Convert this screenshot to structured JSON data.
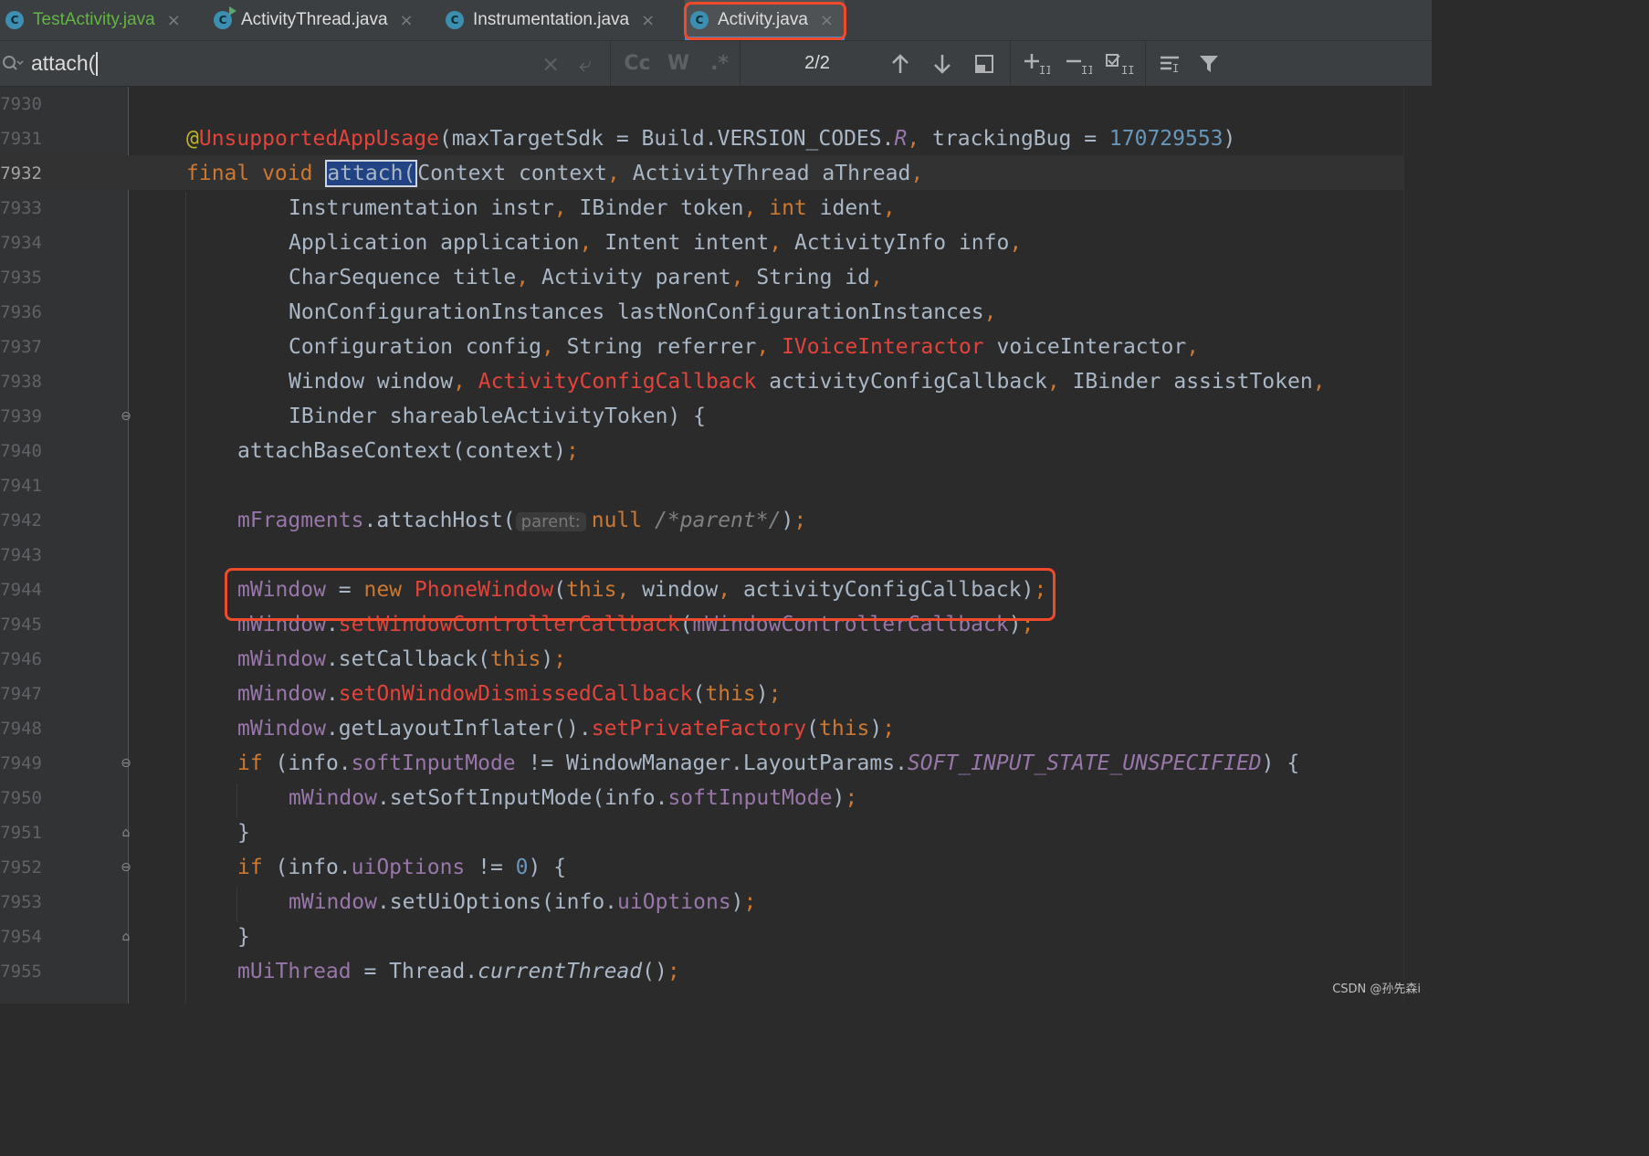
{
  "tabs": [
    {
      "label": "TestActivity.java",
      "close": "×"
    },
    {
      "label": "ActivityThread.java",
      "close": "×"
    },
    {
      "label": "Instrumentation.java",
      "close": "×"
    },
    {
      "label": "Activity.java",
      "close": "×"
    }
  ],
  "tab_icon_letter": "C",
  "search": {
    "query": "attach(",
    "match_count": "2/2",
    "case_toggle": "Cc",
    "words_toggle": "W",
    "regex_toggle": ".*",
    "clear": "×",
    "history": "⤶"
  },
  "highlight_colors": {
    "callout_box": "#ef4a2b",
    "search_match": "#214283",
    "active_tab_underline": "#4a88c7"
  },
  "line_numbers": [
    "7930",
    "7931",
    "7932",
    "7933",
    "7934",
    "7935",
    "7936",
    "7937",
    "7938",
    "7939",
    "7940",
    "7941",
    "7942",
    "7943",
    "7944",
    "7945",
    "7946",
    "7947",
    "7948",
    "7949",
    "7950",
    "7951",
    "7952",
    "7953",
    "7954",
    "7955"
  ],
  "current_line": "7932",
  "code": {
    "l7931_at": "@",
    "l7931_ann": "UnsupportedAppUsage",
    "l7931_mid": "(maxTargetSdk = Build.VERSION_CODES.",
    "l7931_r": "R",
    "l7931_comma": ",",
    "l7931_tb": " trackingBug = ",
    "l7931_num": "170729553",
    "l7931_end": ")",
    "l7932_kw": "final void ",
    "l7932_match": "attach(",
    "l7932_a": "Context context",
    "l7932_c1": ",",
    "l7932_b": " ActivityThread aThread",
    "l7932_c2": ",",
    "l7933_a": "Instrumentation instr",
    "l7933_c1": ",",
    "l7933_b": " IBinder token",
    "l7933_c2": ",",
    "l7933_kw": " int",
    "l7933_c": " ident",
    "l7933_c3": ",",
    "l7934_a": "Application application",
    "l7934_c1": ",",
    "l7934_b": " Intent intent",
    "l7934_c2": ",",
    "l7934_c": " ActivityInfo info",
    "l7934_c3": ",",
    "l7935_a": "CharSequence title",
    "l7935_c1": ",",
    "l7935_b": " Activity parent",
    "l7935_c2": ",",
    "l7935_c": " String id",
    "l7935_c3": ",",
    "l7936_a": "NonConfigurationInstances lastNonConfigurationInstances",
    "l7936_c1": ",",
    "l7937_a": "Configuration config",
    "l7937_c1": ",",
    "l7937_b": " String referrer",
    "l7937_c2": ",",
    "l7937_err": " IVoiceInteractor",
    "l7937_c": " voiceInteractor",
    "l7937_c3": ",",
    "l7938_a": "Window window",
    "l7938_c1": ",",
    "l7938_err": " ActivityConfigCallback",
    "l7938_b": " activityConfigCallback",
    "l7938_c2": ",",
    "l7938_c": " IBinder assistToken",
    "l7938_c3": ",",
    "l7939_a": "IBinder shareableActivityToken) {",
    "l7940_a": "attachBaseContext(context)",
    "l7940_semi": ";",
    "l7942_fld": "mFragments",
    "l7942_a": ".attachHost(",
    "l7942_hint": "parent:",
    "l7942_kw": "null",
    "l7942_cmt": " /*parent*/",
    "l7942_b": ")",
    "l7942_semi": ";",
    "l7944_fld": "mWindow",
    "l7944_a": " = ",
    "l7944_kw": "new",
    "l7944_err": " PhoneWindow",
    "l7944_b": "(",
    "l7944_this": "this",
    "l7944_c1": ",",
    "l7944_c": " window",
    "l7944_c2": ",",
    "l7944_d": " activityConfigCallback)",
    "l7944_semi": ";",
    "l7945_fld": "mWindow",
    "l7945_a": ".",
    "l7945_err": "setWindowControllerCallback",
    "l7945_b": "(",
    "l7945_fld2": "mWindowControllerCallback",
    "l7945_c": ")",
    "l7945_semi": ";",
    "l7946_fld": "mWindow",
    "l7946_a": ".setCallback(",
    "l7946_this": "this",
    "l7946_b": ")",
    "l7946_semi": ";",
    "l7947_fld": "mWindow",
    "l7947_a": ".",
    "l7947_err": "setOnWindowDismissedCallback",
    "l7947_b": "(",
    "l7947_this": "this",
    "l7947_c": ")",
    "l7947_semi": ";",
    "l7948_fld": "mWindow",
    "l7948_a": ".getLayoutInflater().",
    "l7948_err": "setPrivateFactory",
    "l7948_b": "(",
    "l7948_this": "this",
    "l7948_c": ")",
    "l7948_semi": ";",
    "l7949_kw": "if",
    "l7949_a": " (info.",
    "l7949_fld": "softInputMode",
    "l7949_b": " != WindowManager.LayoutParams.",
    "l7949_const": "SOFT_INPUT_STATE_UNSPECIFIED",
    "l7949_c": ") {",
    "l7950_fld": "mWindow",
    "l7950_a": ".setSoftInputMode(info.",
    "l7950_fld2": "softInputMode",
    "l7950_b": ")",
    "l7950_semi": ";",
    "l7951_a": "}",
    "l7952_kw": "if",
    "l7952_a": " (info.",
    "l7952_fld": "uiOptions",
    "l7952_b": " != ",
    "l7952_num": "0",
    "l7952_c": ") {",
    "l7953_fld": "mWindow",
    "l7953_a": ".setUiOptions(info.",
    "l7953_fld2": "uiOptions",
    "l7953_b": ")",
    "l7953_semi": ";",
    "l7954_a": "}",
    "l7955_fld": "mUiThread",
    "l7955_a": " = Thread.",
    "l7955_ital": "currentThread",
    "l7955_b": "()",
    "l7955_semi": ";"
  },
  "watermark": "CSDN @孙先森i"
}
